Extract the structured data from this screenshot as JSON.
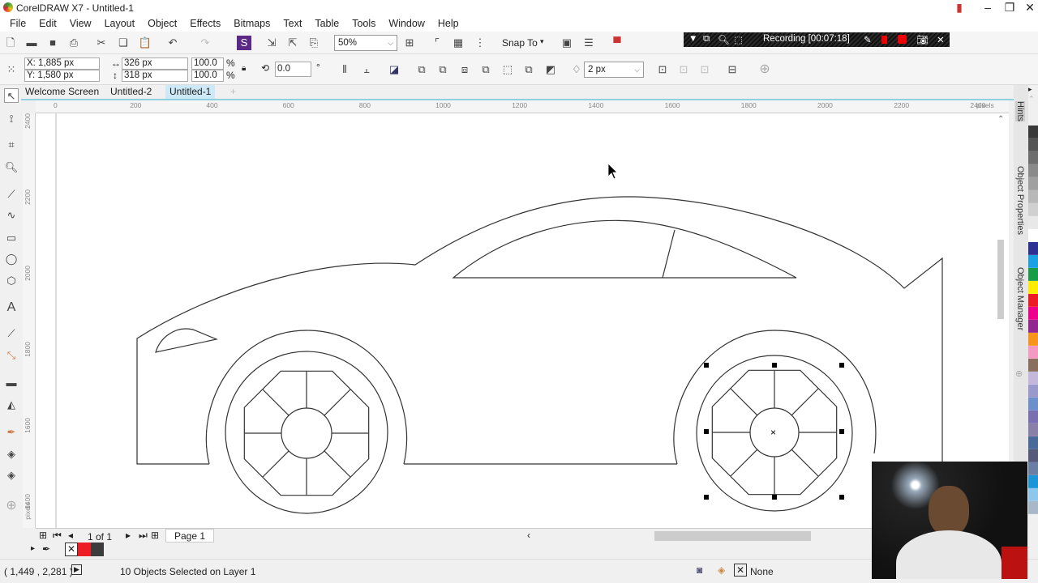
{
  "app": {
    "title": "CorelDRAW X7 - Untitled-1"
  },
  "menu": [
    "File",
    "Edit",
    "View",
    "Layout",
    "Object",
    "Effects",
    "Bitmaps",
    "Text",
    "Table",
    "Tools",
    "Window",
    "Help"
  ],
  "toolbar": {
    "zoom": "50%",
    "snap_to": "Snap To"
  },
  "recording": {
    "label": "Recording [00:07:18]"
  },
  "properties": {
    "x": "X: 1,885 px",
    "y": "Y: 1,580 px",
    "width": "326 px",
    "height": "318 px",
    "scale_x": "100.0",
    "scale_y": "100.0",
    "pct": "%",
    "rotation": "0.0",
    "deg": "°",
    "outline_width": "2 px"
  },
  "tabs": [
    "Welcome Screen",
    "Untitled-2",
    "Untitled-1"
  ],
  "active_tab": "Untitled-1",
  "hruler": {
    "labels": [
      "0",
      "200",
      "400",
      "600",
      "800",
      "1000",
      "1200",
      "1400",
      "1600",
      "1800",
      "2000",
      "2200",
      "2400"
    ],
    "unit": "pixels"
  },
  "vruler": {
    "labels": [
      "2400",
      "2200",
      "2000",
      "1800",
      "1600",
      "1400"
    ],
    "unit": "pixels"
  },
  "dockers": [
    "Hints",
    "Object Properties",
    "Object Manager"
  ],
  "palette": [
    "#3a3a3a",
    "#555555",
    "#6e6e6e",
    "#8a8a8a",
    "#a0a0a0",
    "#b8b8b8",
    "#d0d0d0",
    "#e8e8e8",
    "#ffffff",
    "#2e3192",
    "#1ba1e2",
    "#1a9b48",
    "#ffec00",
    "#ed1c24",
    "#ec008c",
    "#92278f",
    "#f7941d",
    "#f49ac1",
    "#8b6f5e",
    "#c3b8dc",
    "#9999cc",
    "#6d8fcb",
    "#7a6fb0",
    "#8a7fa6",
    "#4a6a9a",
    "#56597a",
    "#6b7fa5",
    "#1b95d8",
    "#8dc8ec",
    "#a8b8c8"
  ],
  "pagebar": {
    "page_count": "1 of 1",
    "page_tab": "Page 1"
  },
  "document_colors": [
    "#ed1c24",
    "#3c3c3c"
  ],
  "status": {
    "cursor": "( 1,449 , 2,281 )",
    "selection": "10 Objects Selected on Layer 1",
    "fill": "None"
  }
}
